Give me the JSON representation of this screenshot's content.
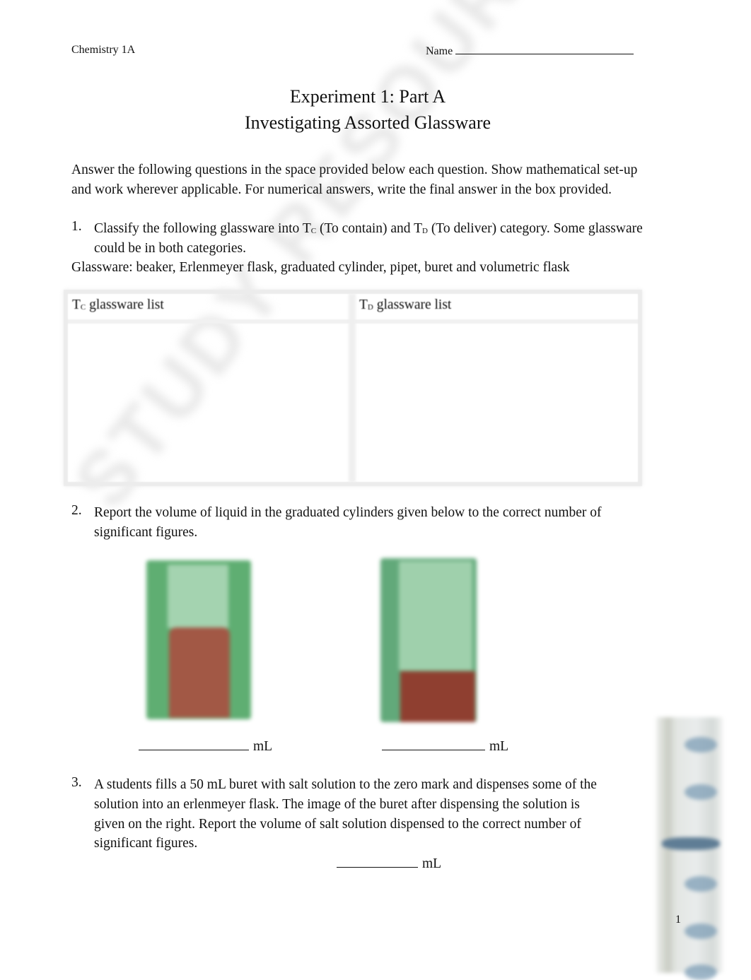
{
  "header": {
    "course": "Chemistry 1A",
    "name_label": "Name"
  },
  "title": {
    "line1": "Experiment 1: Part A",
    "line2": "Investigating Assorted Glassware"
  },
  "instructions": {
    "line1": "Answer the following questions in the space provided below each question. Show mathematical set-up",
    "line2": "and work wherever applicable. For numerical answers, write the final answer in the box provided."
  },
  "q1": {
    "number": "1.",
    "text_a": "Classify the following glassware into T",
    "sub_c": "C",
    "text_b": " (To contain) and T",
    "sub_d": "D",
    "text_c": " (To deliver) category. Some glassware",
    "line2": "could be in both categories.",
    "glassware_line": "Glassware:  beaker, Erlenmeyer flask, graduated cylinder, pipet, buret and volumetric flask",
    "table": {
      "col1_prefix": "T",
      "col1_sub": "C",
      "col1_label": " glassware list",
      "col2_prefix": "T",
      "col2_sub": "D",
      "col2_label": " glassware list"
    }
  },
  "q2": {
    "number": "2.",
    "line1": "Report the volume of liquid in the graduated cylinders given below to the correct number of",
    "line2": "significant figures.",
    "answers": [
      {
        "unit": "mL",
        "value": ""
      },
      {
        "unit": "mL",
        "value": ""
      }
    ],
    "colors": {
      "tube": "#5fae72",
      "glass": "#9fd0ac",
      "liquid": "#9a4a38"
    }
  },
  "q3": {
    "number": "3.",
    "line1": "A students fills a 50 mL buret with salt solution to the zero mark and dispenses some of the",
    "line2": "solution into an erlenmeyer flask. The image of the buret after dispensing the solution is",
    "line3": "given on the right. Report the volume of salt solution dispensed to the correct number of",
    "line4": "significant figures.",
    "answer_unit": "mL",
    "answer_value": ""
  },
  "watermark": "STUDY RESOURCE — DO NOT POST",
  "page_number": "1"
}
